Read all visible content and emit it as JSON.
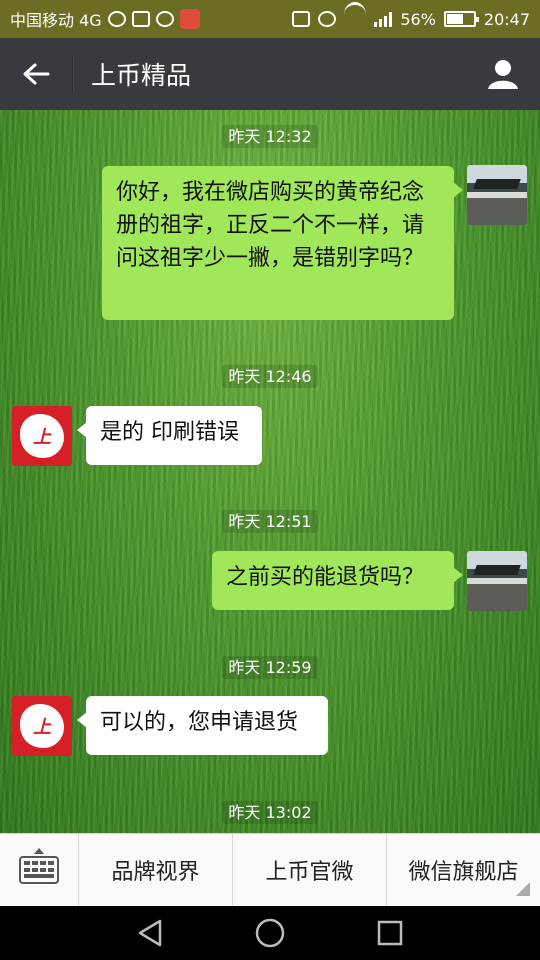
{
  "status_bar": {
    "carrier": "中国移动 4G",
    "battery": "56%",
    "time": "20:47",
    "network": "4G"
  },
  "header": {
    "title": "上币精品",
    "back_icon": "arrow-left-icon",
    "profile_icon": "person-icon"
  },
  "messages": [
    {
      "time": "昨天 12:32",
      "side": "right",
      "text": "你好，我在微店购买的黄帝纪念册的祖字，正反二个不一样，请问这祖字少一撇，是错别字吗？"
    },
    {
      "time": "昨天 12:46",
      "side": "left",
      "text": "是的 印刷错误"
    },
    {
      "time": "昨天 12:51",
      "side": "right",
      "text": "之前买的能退货吗？"
    },
    {
      "time": "昨天 12:59",
      "side": "left",
      "text": "可以的，您申请退货"
    },
    {
      "time": "昨天 13:02"
    }
  ],
  "bottom_menu": {
    "keyboard_icon": "keyboard-icon",
    "items": [
      "品牌视界",
      "上币官微",
      "微信旗舰店"
    ]
  },
  "colors": {
    "title_bar": "#393a3f",
    "bubble_sent": "#a0e75a",
    "bubble_received": "#ffffff",
    "brand_red": "#d61f26"
  }
}
